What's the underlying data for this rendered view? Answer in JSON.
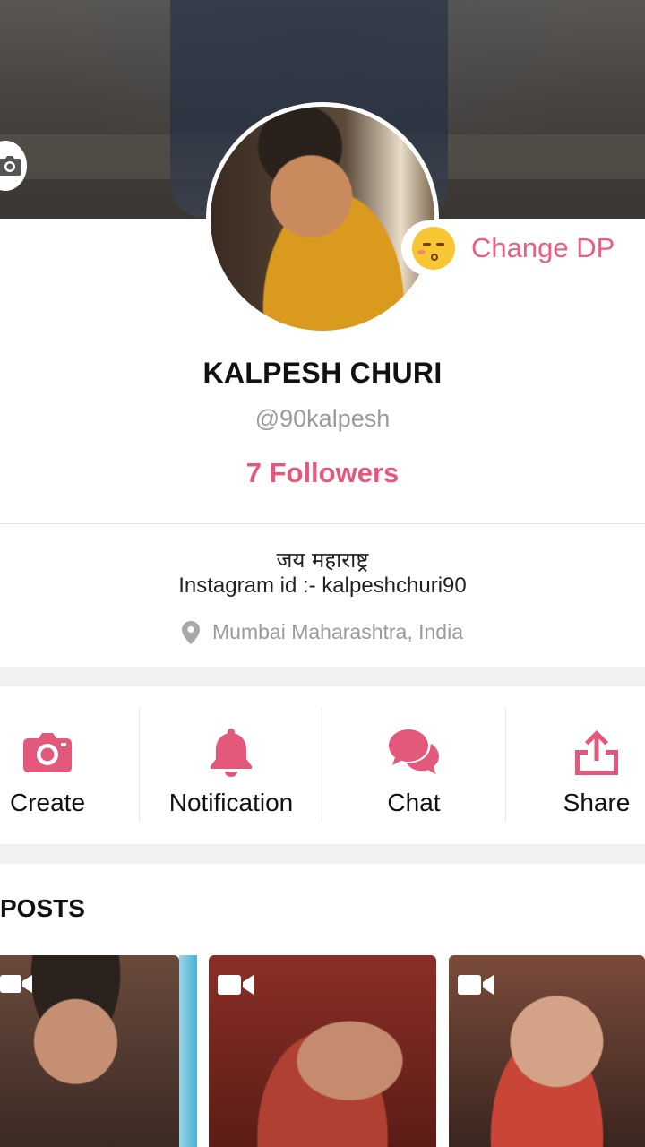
{
  "profile": {
    "name": "KALPESH CHURI",
    "handle": "@90kalpesh",
    "followers": "7 Followers",
    "change_dp_label": "Change DP",
    "bio_line1": "जय महाराष्ट्र",
    "bio_line2": "Instagram id :- kalpeshchuri90",
    "location": "Mumbai Maharashtra, India"
  },
  "actions": [
    {
      "label": "Create",
      "icon": "camera-icon"
    },
    {
      "label": "Notification",
      "icon": "bell-icon"
    },
    {
      "label": "Chat",
      "icon": "chat-bubbles-icon"
    },
    {
      "label": "Share",
      "icon": "share-icon"
    }
  ],
  "posts": {
    "title": "POSTS",
    "items": [
      {
        "type": "video",
        "icon": "video-camera-icon"
      },
      {
        "type": "video",
        "icon": "video-camera-icon"
      },
      {
        "type": "video",
        "icon": "video-camera-icon"
      }
    ]
  },
  "colors": {
    "accent": "#e2597b",
    "muted_text": "#9a9a9a",
    "separator": "#f1f1f1"
  }
}
